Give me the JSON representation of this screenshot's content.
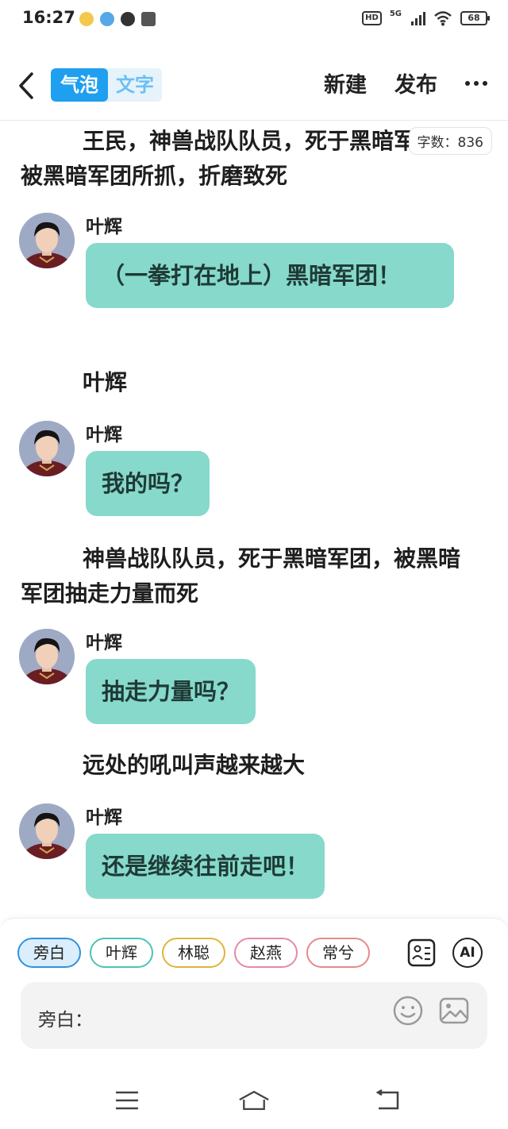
{
  "status_bar": {
    "time": "16:27",
    "hd": "HD",
    "network": "5G",
    "battery": "68"
  },
  "header": {
    "mode_active": "气泡",
    "mode_inactive": "文字",
    "new_label": "新建",
    "publish_label": "发布"
  },
  "word_count": "字数：836",
  "blocks": [
    {
      "type": "narration",
      "text": "王民，神兽战队队员，死于黑暗军团，被黑暗军团所抓，折磨致死"
    },
    {
      "type": "message",
      "speaker": "叶辉",
      "text": "（一拳打在地上）黑暗军团！"
    },
    {
      "type": "narration",
      "text": "叶辉"
    },
    {
      "type": "message",
      "speaker": "叶辉",
      "text": "我的吗？"
    },
    {
      "type": "narration",
      "text": "神兽战队队员，死于黑暗军团，被黑暗军团抽走力量而死"
    },
    {
      "type": "message",
      "speaker": "叶辉",
      "text": "抽走力量吗？"
    },
    {
      "type": "narration",
      "text": "远处的吼叫声越来越大"
    },
    {
      "type": "message",
      "speaker": "叶辉",
      "text": "还是继续往前走吧！"
    }
  ],
  "characters": [
    {
      "name": "旁白",
      "color": "#2f93e0",
      "active": true
    },
    {
      "name": "叶辉",
      "color": "#4cc4b4"
    },
    {
      "name": "林聪",
      "color": "#e0b53a"
    },
    {
      "name": "赵燕",
      "color": "#e58aa4"
    },
    {
      "name": "常兮",
      "color": "#e58a8a"
    }
  ],
  "ai_label": "AI",
  "input": {
    "label": "旁白："
  }
}
